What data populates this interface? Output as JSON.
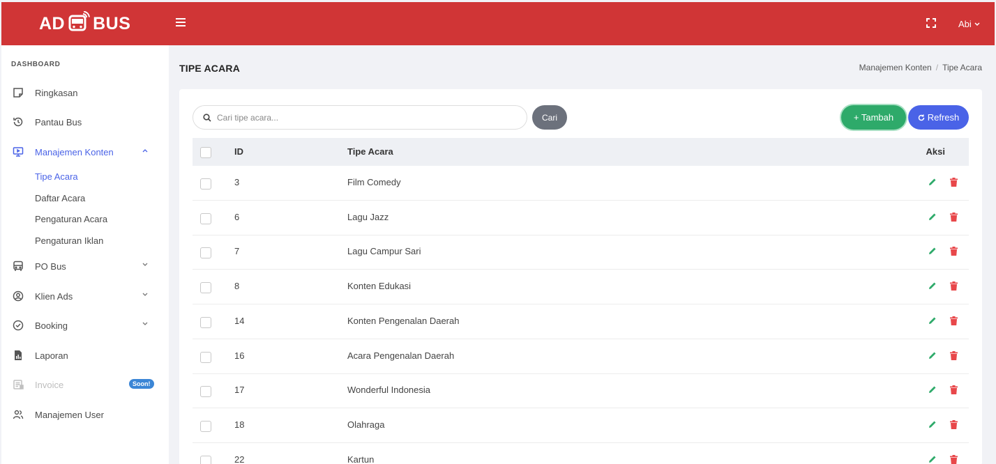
{
  "header": {
    "logo_left": "AD",
    "logo_right": "BUS",
    "user_name": "Abi"
  },
  "sidebar": {
    "heading": "DASHBOARD",
    "items": [
      {
        "label": "Ringkasan",
        "icon": "note-icon"
      },
      {
        "label": "Pantau Bus",
        "icon": "history-icon"
      },
      {
        "label": "Manajemen Konten",
        "icon": "monitor-icon"
      },
      {
        "label": "PO Bus",
        "icon": "bus-icon"
      },
      {
        "label": "Klien Ads",
        "icon": "user-circle-icon"
      },
      {
        "label": "Booking",
        "icon": "check-circle-icon"
      },
      {
        "label": "Laporan",
        "icon": "report-file-icon"
      },
      {
        "label": "Invoice",
        "icon": "invoice-icon"
      },
      {
        "label": "Manajemen User",
        "icon": "users-icon"
      }
    ],
    "submenu": [
      "Tipe Acara",
      "Daftar Acara",
      "Pengaturan Acara",
      "Pengaturan Iklan"
    ],
    "soon_badge": "Soon!"
  },
  "page": {
    "title": "TIPE ACARA",
    "breadcrumb": [
      "Manajemen Konten",
      "Tipe Acara"
    ]
  },
  "toolbar": {
    "search_placeholder": "Cari tipe acara...",
    "search_button": "Cari",
    "add_button": "+ Tambah",
    "refresh_button": "Refresh"
  },
  "table": {
    "columns": [
      "ID",
      "Tipe Acara",
      "Aksi"
    ],
    "rows": [
      {
        "id": "3",
        "tipe": "Film Comedy"
      },
      {
        "id": "6",
        "tipe": "Lagu Jazz"
      },
      {
        "id": "7",
        "tipe": "Lagu Campur Sari"
      },
      {
        "id": "8",
        "tipe": "Konten Edukasi"
      },
      {
        "id": "14",
        "tipe": "Konten Pengenalan Daerah"
      },
      {
        "id": "16",
        "tipe": "Acara Pengenalan Daerah"
      },
      {
        "id": "17",
        "tipe": "Wonderful Indonesia"
      },
      {
        "id": "18",
        "tipe": "Olahraga"
      },
      {
        "id": "22",
        "tipe": "Kartun"
      }
    ]
  },
  "colors": {
    "brand_red": "#d03536",
    "accent_blue": "#4a63e7",
    "add_green": "#2eaa6a",
    "delete_red": "#e8474a",
    "edit_green": "#2eaa6a"
  }
}
